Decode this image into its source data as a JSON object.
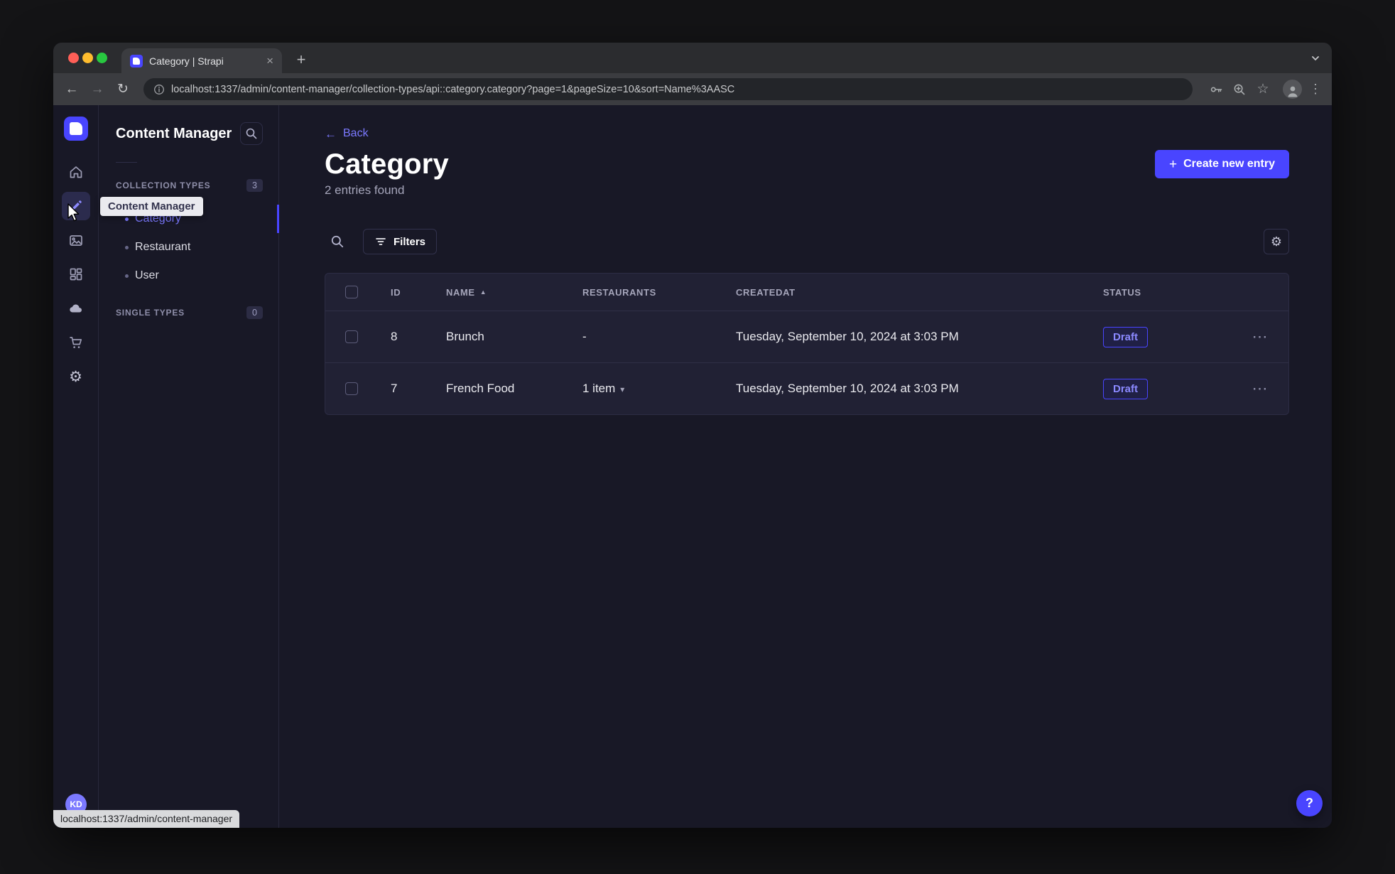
{
  "colors": {
    "accent": "#4945ff",
    "accent_light": "#7b79ff",
    "app_background": "#181826",
    "card_background": "#212134",
    "border": "#32324d",
    "text_muted": "#a5a5ba",
    "status_draft_text": "#8b89ff"
  },
  "icons": {
    "close": "×",
    "new_tab": "+",
    "back_arrow": "←",
    "forward_arrow": "→",
    "reload": "↻",
    "star": "☆",
    "dots_vertical": "⋮",
    "more_horizontal": "⋯",
    "sort_asc": "▲",
    "caret_down": "▾",
    "gear": "⚙",
    "plus": "+"
  },
  "browser": {
    "tab_title": "Category | Strapi",
    "url": "localhost:1337/admin/content-manager/collection-types/api::category.category?page=1&pageSize=10&sort=Name%3AASC",
    "status_text": "localhost:1337/admin/content-manager"
  },
  "rail": {
    "tooltip": "Content Manager",
    "avatar_initials": "KD",
    "items": [
      "home",
      "content-manager",
      "media-library",
      "content-type-builder",
      "cloud",
      "marketplace",
      "settings"
    ]
  },
  "subnav": {
    "title": "Content Manager",
    "collection_types": {
      "label": "COLLECTION TYPES",
      "badge": "3",
      "items": [
        {
          "label": "Category",
          "active": true
        },
        {
          "label": "Restaurant",
          "active": false
        },
        {
          "label": "User",
          "active": false
        }
      ]
    },
    "single_types": {
      "label": "SINGLE TYPES",
      "badge": "0"
    }
  },
  "main": {
    "back_label": "Back",
    "title": "Category",
    "subtitle": "2 entries found",
    "create_button": "Create new entry",
    "filters_button": "Filters",
    "help_label": "?",
    "table": {
      "headers": {
        "id": "ID",
        "name": "NAME",
        "restaurants": "RESTAURANTS",
        "createdat": "CREATEDAT",
        "status": "STATUS"
      },
      "rows": [
        {
          "id": "8",
          "name": "Brunch",
          "restaurants": "-",
          "createdat": "Tuesday, September 10, 2024 at 3:03 PM",
          "status": "Draft"
        },
        {
          "id": "7",
          "name": "French Food",
          "restaurants": "1 item",
          "createdat": "Tuesday, September 10, 2024 at 3:03 PM",
          "status": "Draft"
        }
      ]
    }
  }
}
